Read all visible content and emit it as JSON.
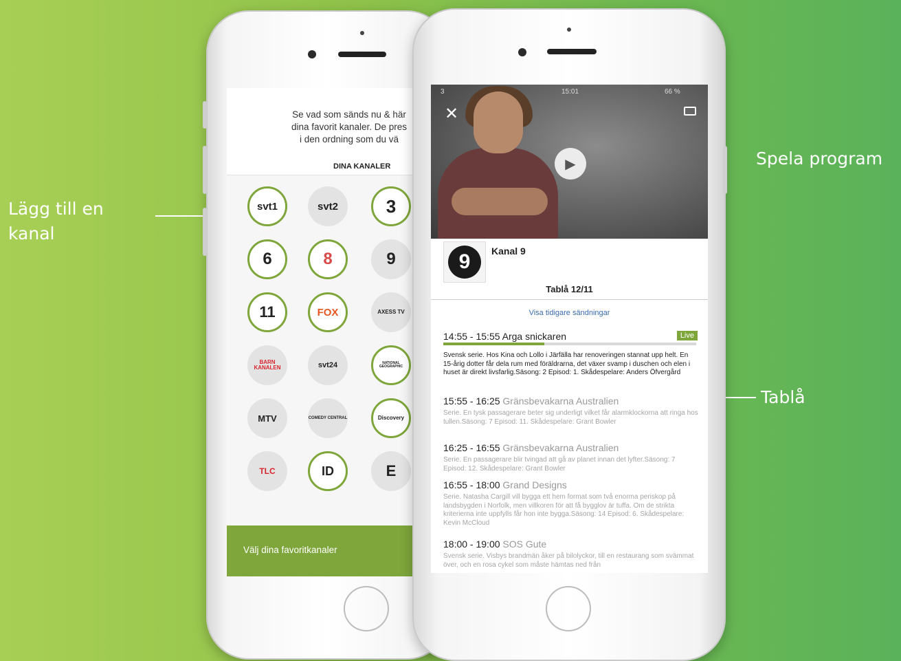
{
  "callouts": {
    "add_channel": "Lägg till en kanal",
    "play_program": "Spela program",
    "schedule": "Tablå"
  },
  "left_screen": {
    "intro_text": "Se vad som sänds nu & här\ndina favorit kanaler. De pres\ni den ordning som du vä",
    "section_title": "DINA KANALER",
    "channels": [
      {
        "name": "svt1",
        "selected": true
      },
      {
        "name": "svt2",
        "selected": false
      },
      {
        "name": "3",
        "selected": true
      },
      {
        "name": "6",
        "selected": true
      },
      {
        "name": "8",
        "selected": true
      },
      {
        "name": "9",
        "selected": false
      },
      {
        "name": "11",
        "selected": true
      },
      {
        "name": "FOX",
        "selected": true
      },
      {
        "name": "AXESS TV",
        "selected": false
      },
      {
        "name": "BARN KANALEN",
        "selected": false
      },
      {
        "name": "svt24",
        "selected": false
      },
      {
        "name": "NATIONAL GEOGRAPHIC",
        "selected": true
      },
      {
        "name": "MTV",
        "selected": false
      },
      {
        "name": "COMEDY CENTRAL",
        "selected": false
      },
      {
        "name": "Discovery",
        "selected": true
      },
      {
        "name": "TLC",
        "selected": false
      },
      {
        "name": "ID",
        "selected": true
      },
      {
        "name": "E",
        "selected": false
      }
    ],
    "bottom_bar": "Välj dina favoritkanaler",
    "accent_color": "#7ea63b"
  },
  "right_screen": {
    "status": {
      "carrier": "3",
      "time": "15:01",
      "battery": "66 %"
    },
    "channel_name": "Kanal 9",
    "schedule_title": "Tablå 12/11",
    "show_earlier": "Visa tidigare sändningar",
    "live_label": "Live",
    "live_progress": 0.4,
    "programs": [
      {
        "time": "14:55 - 15:55",
        "title": "Arga snickaren",
        "desc": "Svensk serie. Hos Kina och Lollo i Järfälla har renoveringen stannat upp helt. En 15-årig dotter får dela rum med föräldrarna, det växer svamp i duschen och elen i huset är direkt livsfarlig.Säsong: 2 Episod: 1. Skådespelare: Anders Öfvergård"
      },
      {
        "time": "15:55 - 16:25",
        "title": "Gränsbevakarna Australien",
        "desc": "Serie. En tysk passagerare beter sig underligt vilket får alarmklockorna att ringa hos tullen.Säsong: 7 Episod: 11. Skådespelare: Grant Bowler"
      },
      {
        "time": "16:25 - 16:55",
        "title": "Gränsbevakarna Australien",
        "desc": "Serie. En passagerare blir tvingad att gå av planet innan det lyfter.Säsong: 7 Episod: 12. Skådespelare: Grant Bowler"
      },
      {
        "time": "16:55 - 18:00",
        "title": "Grand Designs",
        "desc": "Serie. Natasha Cargill vill bygga ett hem format som två enorma periskop på landsbygden i Norfolk, men villkoren för att få bygglov är tuffa. Om de strikta kriterierna inte uppfylls får hon inte bygga.Säsong: 14 Episod: 6. Skådespelare: Kevin McCloud"
      },
      {
        "time": "18:00 - 19:00",
        "title": "SOS Gute",
        "desc": "Svensk serie. Visbys brandmän åker på bilolyckor, till en restaurang som svämmat över, och en rosa cykel som måste hämtas ned från"
      }
    ]
  }
}
